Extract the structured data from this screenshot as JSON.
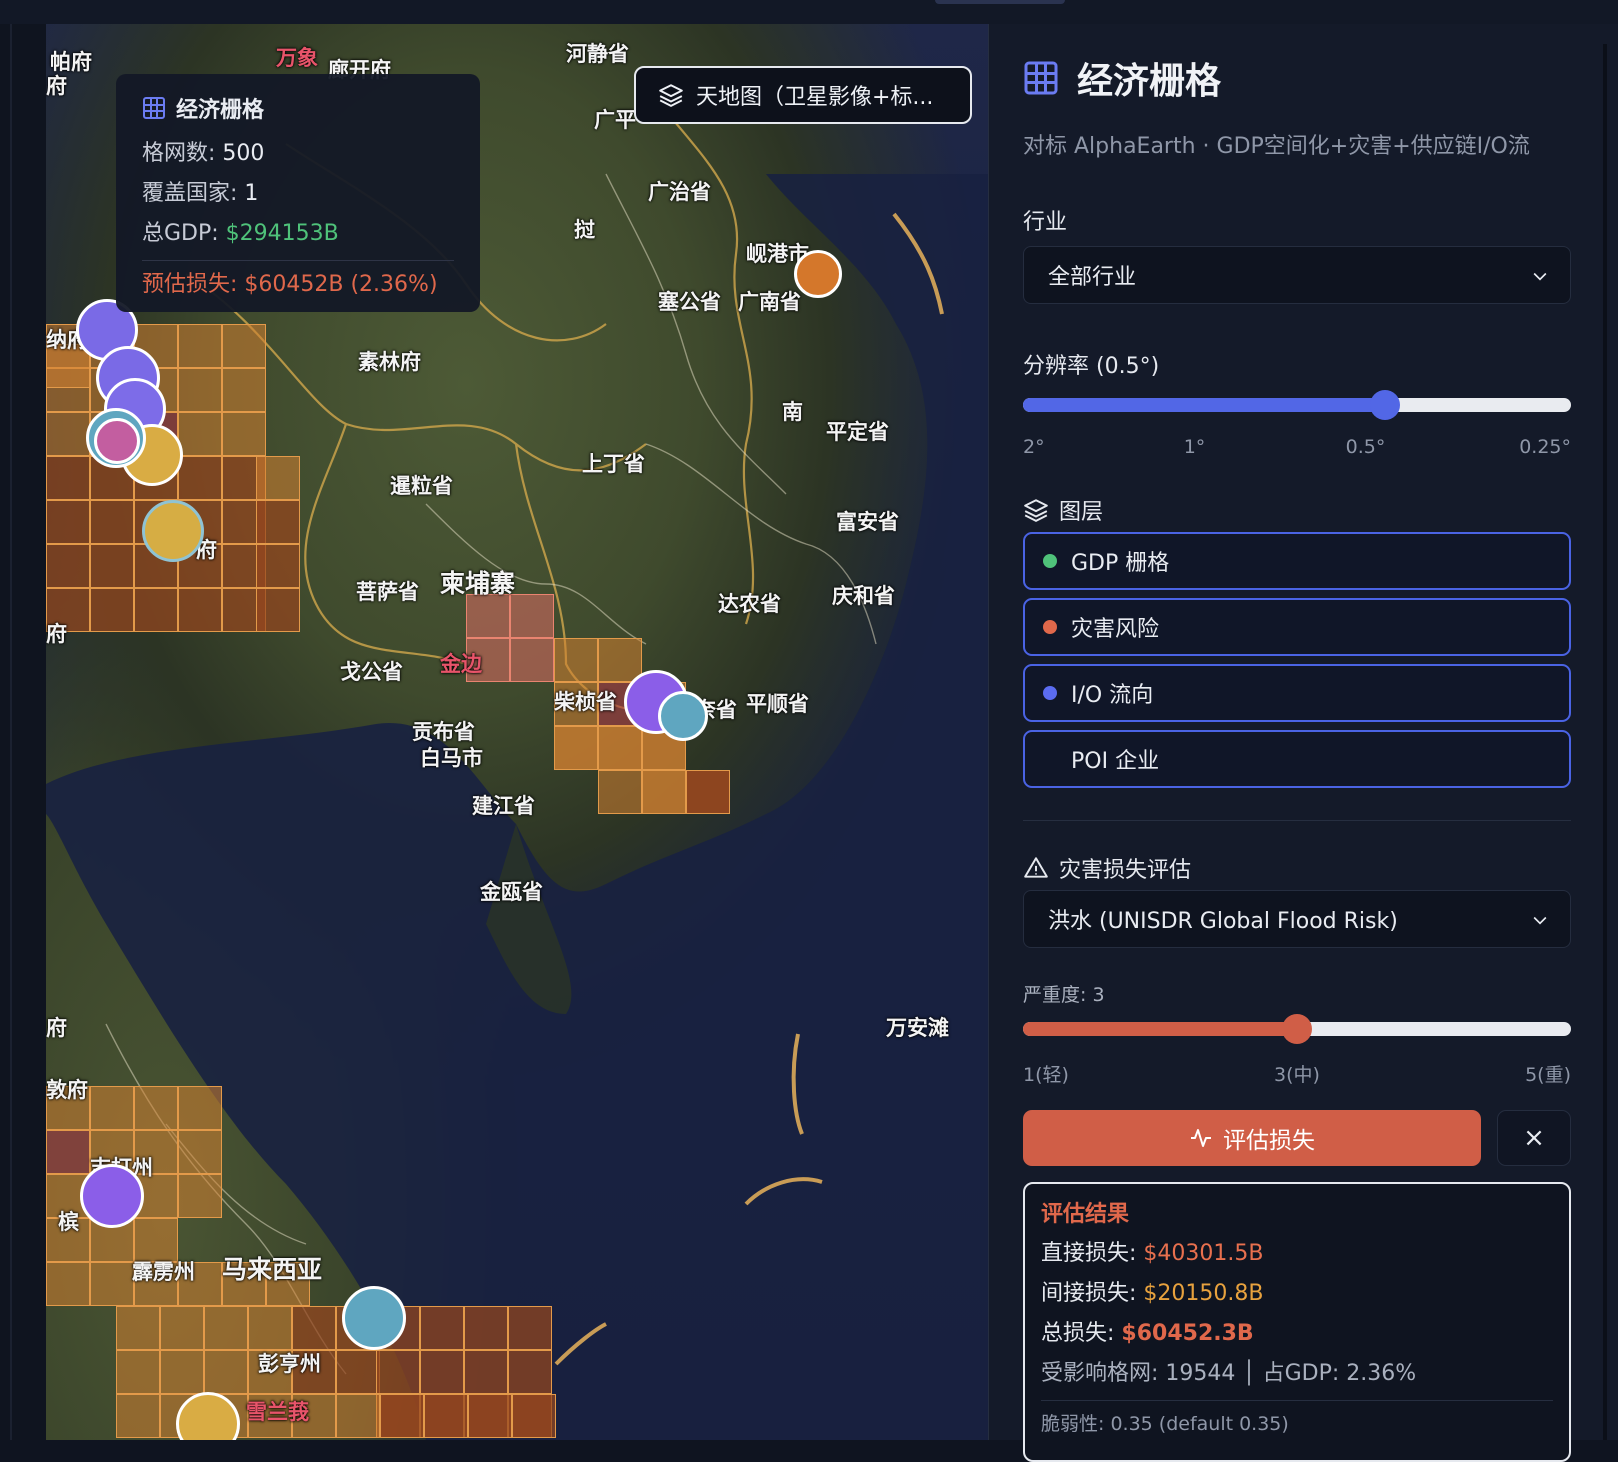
{
  "map": {
    "basemap_label": "天地图（卫星影像+标...",
    "places": [
      {
        "t": "帕府",
        "c": ""
      },
      {
        "t": "万象",
        "c": "red"
      },
      {
        "t": "廊开府",
        "c": ""
      },
      {
        "t": "河静省",
        "c": ""
      },
      {
        "t": "广平",
        "c": ""
      },
      {
        "t": "广治省",
        "c": ""
      },
      {
        "t": "挝",
        "c": ""
      },
      {
        "t": "岘港市",
        "c": ""
      },
      {
        "t": "塞公省",
        "c": ""
      },
      {
        "t": "广南省",
        "c": ""
      },
      {
        "t": "纳府",
        "c": ""
      },
      {
        "t": "素林府",
        "c": ""
      },
      {
        "t": "南",
        "c": ""
      },
      {
        "t": "平定省",
        "c": ""
      },
      {
        "t": "上丁省",
        "c": ""
      },
      {
        "t": "暹粒省",
        "c": ""
      },
      {
        "t": "富安省",
        "c": ""
      },
      {
        "t": "府",
        "c": ""
      },
      {
        "t": "菩萨省",
        "c": ""
      },
      {
        "t": "柬埔寨",
        "c": "big"
      },
      {
        "t": "达农省",
        "c": ""
      },
      {
        "t": "庆和省",
        "c": ""
      },
      {
        "t": "府",
        "c": ""
      },
      {
        "t": "戈公省",
        "c": ""
      },
      {
        "t": "金边",
        "c": "red"
      },
      {
        "t": "柴桢省",
        "c": ""
      },
      {
        "t": "同奈省",
        "c": ""
      },
      {
        "t": "平顺省",
        "c": ""
      },
      {
        "t": "贡布省",
        "c": ""
      },
      {
        "t": "白马市",
        "c": ""
      },
      {
        "t": "建江省",
        "c": ""
      },
      {
        "t": "金瓯省",
        "c": ""
      },
      {
        "t": "万安滩",
        "c": ""
      },
      {
        "t": "府",
        "c": ""
      },
      {
        "t": "敦府",
        "c": ""
      },
      {
        "t": "吉打州",
        "c": ""
      },
      {
        "t": "槟",
        "c": ""
      },
      {
        "t": "霹雳州",
        "c": ""
      },
      {
        "t": "马来西亚",
        "c": "big"
      },
      {
        "t": "彭亨州",
        "c": ""
      },
      {
        "t": "雪兰莪",
        "c": "red"
      },
      {
        "t": "府",
        "c": ""
      }
    ]
  },
  "info": {
    "title": "经济栅格",
    "grid_label": "格网数: ",
    "grid_value": "500",
    "country_label": "覆盖国家: ",
    "country_value": "1",
    "gdp_label": "总GDP: ",
    "gdp_value": "$294153B",
    "loss": "预估损失: $60452B (2.36%)"
  },
  "panel": {
    "title": "经济栅格",
    "subtitle": "对标 AlphaEarth · GDP空间化+灾害+供应链I/O流",
    "industry_label": "行业",
    "industry_value": "全部行业",
    "resolution_label": "分辨率 (0.5°)",
    "resolution_ticks": [
      "2°",
      "1°",
      "0.5°",
      "0.25°"
    ],
    "resolution_position": 0.66,
    "layers_label": "图层",
    "layers": [
      {
        "label": "GDP 栅格",
        "color": "#4fc27a"
      },
      {
        "label": "灾害风险",
        "color": "#e0684b"
      },
      {
        "label": "I/O 流向",
        "color": "#5b6cf0"
      },
      {
        "label": "POI 企业",
        "color": ""
      }
    ],
    "hazard_label": "灾害损失评估",
    "hazard_value": "洪水 (UNISDR Global Flood Risk)",
    "severity_label": "严重度: 3",
    "severity_value": 3,
    "severity_ticks": [
      "1(轻)",
      "3(中)",
      "5(重)"
    ],
    "evaluate_label": "评估损失",
    "close_label": "×",
    "result": {
      "title": "评估结果",
      "direct_label": "直接损失: ",
      "direct_value": "$40301.5B",
      "indirect_label": "间接损失: ",
      "indirect_value": "$20150.8B",
      "total_label": "总损失: ",
      "total_value": "$60452.3B",
      "affected": "受影响格网: 19544 │ 占GDP: 2.36%",
      "vulnerability": "脆弱性: 0.35 (default 0.35)"
    }
  },
  "colors": {
    "accent": "#4a63e4",
    "danger": "#d05e47",
    "gdp": "#4fc27a"
  }
}
